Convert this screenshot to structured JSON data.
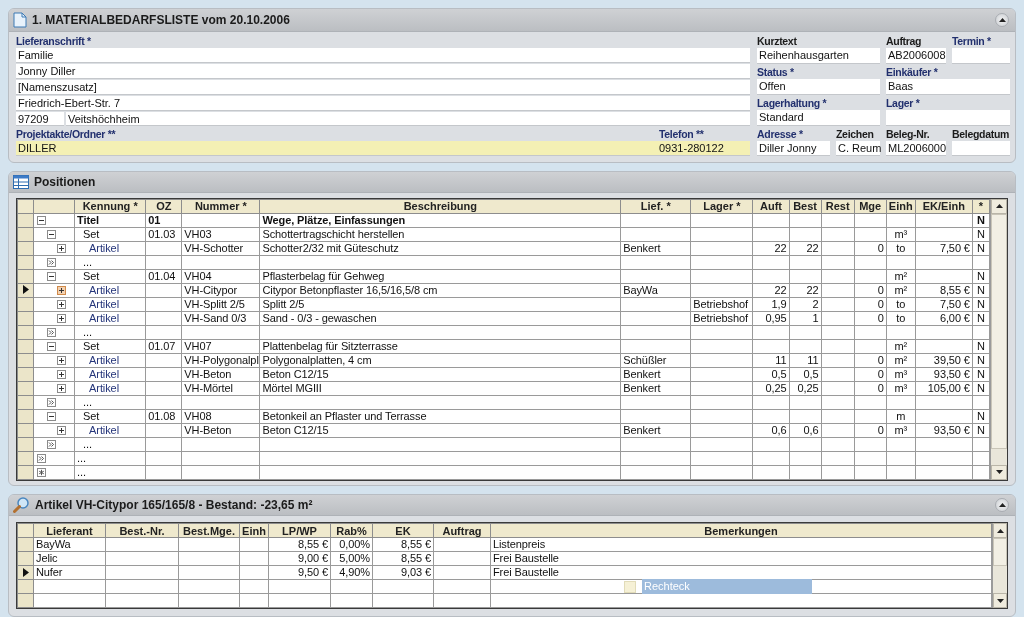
{
  "header": {
    "title": "1. MATERIALBEDARFSLISTE vom 20.10.2006",
    "collapsible": true
  },
  "address": {
    "label": "Lieferanschrift *",
    "required": true,
    "lines": [
      "Familie",
      "Jonny Diller",
      "[Namenszusatz]",
      "Friedrich-Ebert-Str. 7"
    ],
    "zip": "97209",
    "city": "Veitshöchheim"
  },
  "right_fields": [
    [
      {
        "label": "Kurztext",
        "required": false,
        "value": "Reihenhausgarten"
      },
      {
        "label": "Auftrag",
        "required": false,
        "value": "AB2006008"
      },
      {
        "label": "Termin *",
        "required": true
      }
    ],
    [
      {
        "label": "Status *",
        "required": true,
        "value": "Offen"
      },
      {
        "label": "Einkäufer *",
        "required": true,
        "value": "Baas"
      }
    ],
    [
      {
        "label": "Lagerhaltung *",
        "required": true,
        "value": "Standard"
      },
      {
        "label": "Lager *",
        "required": true
      }
    ]
  ],
  "project": {
    "label": "Projektakte/Ordner **",
    "required": true,
    "value": "DILLER",
    "highlighted": true
  },
  "phone": {
    "label": "Telefon **",
    "required": true,
    "value": "0931-280122",
    "highlighted": true
  },
  "bottom_fields": [
    {
      "label": "Adresse *",
      "required": true,
      "value": "Diller Jonny"
    },
    {
      "label": "Zeichen",
      "required": false,
      "value": "C. Reum"
    },
    {
      "label": "Beleg-Nr.",
      "required": false,
      "value": "ML2006000"
    },
    {
      "label": "Belegdatum",
      "required": false
    }
  ],
  "positions": {
    "title": "Positionen",
    "columns": [
      "Kennung *",
      "OZ",
      "Nummer *",
      "Beschreibung",
      "Lief. *",
      "Lager *",
      "Auft",
      "Best",
      "Rest",
      "Mge",
      "Einh",
      "EK/Einh",
      "*"
    ],
    "rows": [
      {
        "kind": "node",
        "expanded": true,
        "selected": false,
        "kennung": "Titel",
        "oz": "01",
        "beschreibung": "Wege, Plätze, Einfassungen",
        "flag": "N",
        "children": [
          {
            "kind": "node",
            "expanded": true,
            "selected": false,
            "kennung": "Set",
            "oz": "01.03",
            "nummer": "VH03",
            "beschreibung": "Schottertragschicht herstellen",
            "einh": "m³",
            "flag": "N",
            "children": [
              {
                "kind": "node",
                "expanded": false,
                "selected": false,
                "kennung": "Artikel",
                "nummer": "VH-Schotter",
                "beschreibung": "Schotter2/32 mit Güteschutz",
                "lief": "Benkert",
                "auft": "22",
                "best": "22",
                "mge": "0",
                "einh": "to",
                "ek": "7,50 €",
                "flag": "N"
              },
              {
                "kind": "more",
                "selected": false,
                "kennung": "..."
              }
            ]
          },
          {
            "kind": "node",
            "expanded": true,
            "selected": false,
            "kennung": "Set",
            "oz": "01.04",
            "nummer": "VH04",
            "beschreibung": "Pflasterbelag für Gehweg",
            "einh": "m²",
            "flag": "N",
            "children": [
              {
                "kind": "node",
                "expanded": false,
                "selected": true,
                "kennung": "Artikel",
                "nummer": "VH-Citypor",
                "beschreibung": "Citypor Betonpflaster 16,5/16,5/8 cm",
                "lief": "BayWa",
                "auft": "22",
                "best": "22",
                "mge": "0",
                "einh": "m²",
                "ek": "8,55 €",
                "flag": "N"
              },
              {
                "kind": "node",
                "expanded": false,
                "selected": false,
                "kennung": "Artikel",
                "nummer": "VH-Splitt 2/5",
                "beschreibung": "Splitt 2/5",
                "lager": "Betriebshof",
                "auft": "1,9",
                "best": "2",
                "mge": "0",
                "einh": "to",
                "ek": "7,50 €",
                "flag": "N"
              },
              {
                "kind": "node",
                "expanded": false,
                "selected": false,
                "kennung": "Artikel",
                "nummer": "VH-Sand 0/3",
                "beschreibung": "Sand - 0/3 - gewaschen",
                "lager": "Betriebshof",
                "auft": "0,95",
                "best": "1",
                "mge": "0",
                "einh": "to",
                "ek": "6,00 €",
                "flag": "N"
              },
              {
                "kind": "more",
                "selected": false,
                "kennung": "..."
              }
            ]
          },
          {
            "kind": "node",
            "expanded": true,
            "selected": false,
            "kennung": "Set",
            "oz": "01.07",
            "nummer": "VH07",
            "beschreibung": "Plattenbelag für Sitzterrasse",
            "einh": "m²",
            "flag": "N",
            "children": [
              {
                "kind": "node",
                "expanded": false,
                "selected": false,
                "kennung": "Artikel",
                "nummer": "VH-Polygonalpl",
                "beschreibung": "Polygonalplatten, 4 cm",
                "lief": "Schüßler",
                "auft": "11",
                "best": "11",
                "mge": "0",
                "einh": "m²",
                "ek": "39,50 €",
                "flag": "N"
              },
              {
                "kind": "node",
                "expanded": false,
                "selected": false,
                "kennung": "Artikel",
                "nummer": "VH-Beton",
                "beschreibung": "Beton C12/15",
                "lief": "Benkert",
                "auft": "0,5",
                "best": "0,5",
                "mge": "0",
                "einh": "m³",
                "ek": "93,50 €",
                "flag": "N"
              },
              {
                "kind": "node",
                "expanded": false,
                "selected": false,
                "kennung": "Artikel",
                "nummer": "VH-Mörtel",
                "beschreibung": "Mörtel MGIII",
                "lief": "Benkert",
                "auft": "0,25",
                "best": "0,25",
                "mge": "0",
                "einh": "m³",
                "ek": "105,00 €",
                "flag": "N"
              },
              {
                "kind": "more",
                "selected": false,
                "kennung": "..."
              }
            ]
          },
          {
            "kind": "node",
            "expanded": true,
            "selected": false,
            "kennung": "Set",
            "oz": "01.08",
            "nummer": "VH08",
            "beschreibung": "Betonkeil an Pflaster und Terrasse",
            "einh": "m",
            "flag": "N",
            "children": [
              {
                "kind": "node",
                "expanded": false,
                "selected": false,
                "kennung": "Artikel",
                "nummer": "VH-Beton",
                "beschreibung": "Beton C12/15",
                "lief": "Benkert",
                "auft": "0,6",
                "best": "0,6",
                "mge": "0",
                "einh": "m³",
                "ek": "93,50 €",
                "flag": "N"
              },
              {
                "kind": "more",
                "selected": false,
                "kennung": "..."
              }
            ]
          }
        ]
      },
      {
        "kind": "more",
        "selected": false,
        "kennung": "..."
      },
      {
        "kind": "new",
        "selected": false,
        "kennung": "..."
      }
    ]
  },
  "article": {
    "title": "Artikel VH-Citypor 165/165/8 - Bestand: -23,65 m²",
    "collapsible": true,
    "columns": [
      "Lieferant",
      "Best.-Nr.",
      "Best.Mge.",
      "Einh",
      "LP/WP",
      "Rab%",
      "EK",
      "Auftrag",
      "Bemerkungen"
    ],
    "rows": [
      {
        "selected": false,
        "lieferant": "BayWa",
        "lp": "8,55 €",
        "rab": "0,00%",
        "ek": "8,55 €",
        "bemerkungen": "Listenpreis"
      },
      {
        "selected": false,
        "lieferant": "Jelic",
        "lp": "9,00 €",
        "rab": "5,00%",
        "ek": "8,55 €",
        "bemerkungen": "Frei Baustelle"
      },
      {
        "selected": true,
        "lieferant": "Nufer",
        "lp": "9,50 €",
        "rab": "4,90%",
        "ek": "9,03 €",
        "bemerkungen": "Frei Baustelle"
      }
    ],
    "drag_hint": "Rechteck"
  }
}
